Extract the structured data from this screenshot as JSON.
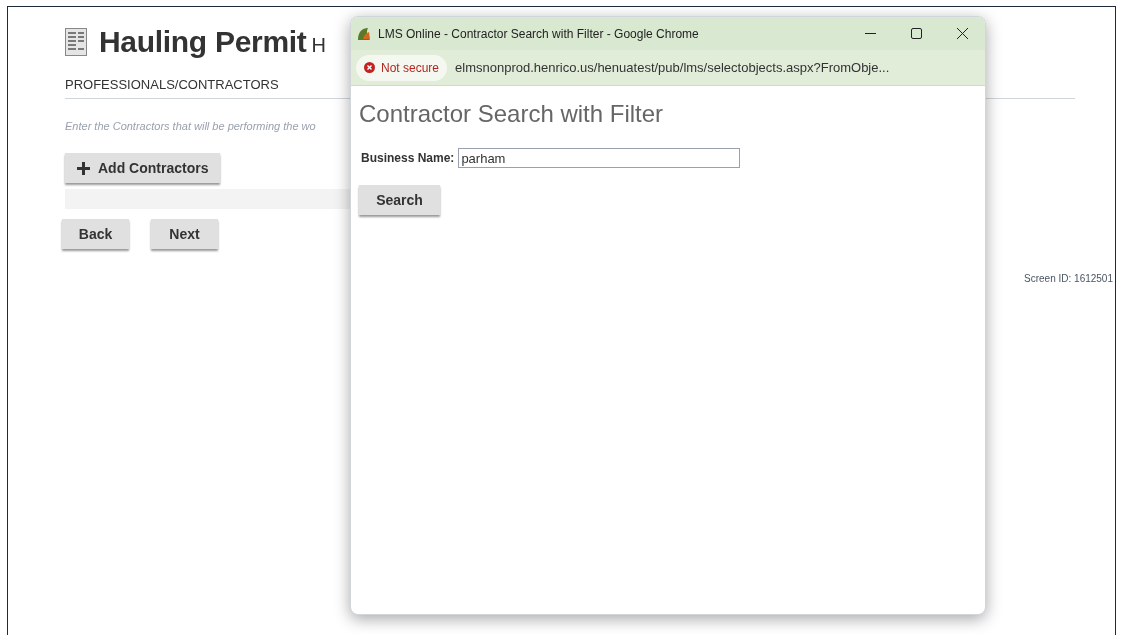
{
  "page": {
    "title": "Hauling Permit",
    "title_suffix": "H",
    "section": "PROFESSIONALS/CONTRACTORS",
    "instructions": "Enter the Contractors that will be performing the wo",
    "add_button": "Add Contractors",
    "nav_buttons": [
      "Back",
      "Next"
    ],
    "screen_id": "Screen ID: 1612501"
  },
  "popup": {
    "window_title": "LMS Online - Contractor Search with Filter - Google Chrome",
    "security": "Not secure",
    "url": "elmsnonprod.henrico.us/henuatest/pub/lms/selectobjects.aspx?FromObje...",
    "heading": "Contractor Search with Filter",
    "field_label": "Business Name:",
    "field_value": "parham",
    "search_button": "Search"
  }
}
